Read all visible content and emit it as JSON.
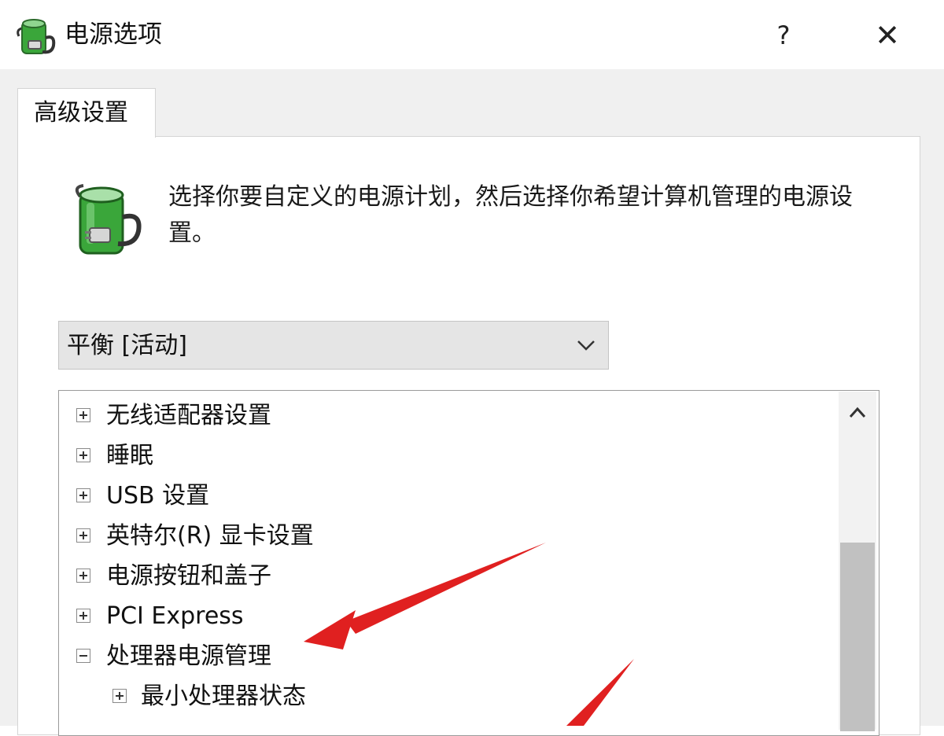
{
  "window": {
    "title": "电源选项",
    "help_label": "?",
    "close_label": "✕"
  },
  "tabs": [
    {
      "label": "高级设置",
      "active": true
    }
  ],
  "description": "选择你要自定义的电源计划，然后选择你希望计算机管理的电源设置。",
  "plan_select": {
    "value": "平衡 [活动]"
  },
  "tree": {
    "items": [
      {
        "label": "无线适配器设置",
        "state": "collapsed",
        "level": 0
      },
      {
        "label": "睡眠",
        "state": "collapsed",
        "level": 0
      },
      {
        "label": "USB 设置",
        "state": "collapsed",
        "level": 0
      },
      {
        "label": "英特尔(R) 显卡设置",
        "state": "collapsed",
        "level": 0
      },
      {
        "label": "电源按钮和盖子",
        "state": "collapsed",
        "level": 0
      },
      {
        "label": "PCI Express",
        "state": "collapsed",
        "level": 0
      },
      {
        "label": "处理器电源管理",
        "state": "expanded",
        "level": 0
      },
      {
        "label": "最小处理器状态",
        "state": "collapsed",
        "level": 1
      }
    ]
  },
  "colors": {
    "annotation_arrow": "#e02020",
    "battery_green": "#3aa63a"
  }
}
